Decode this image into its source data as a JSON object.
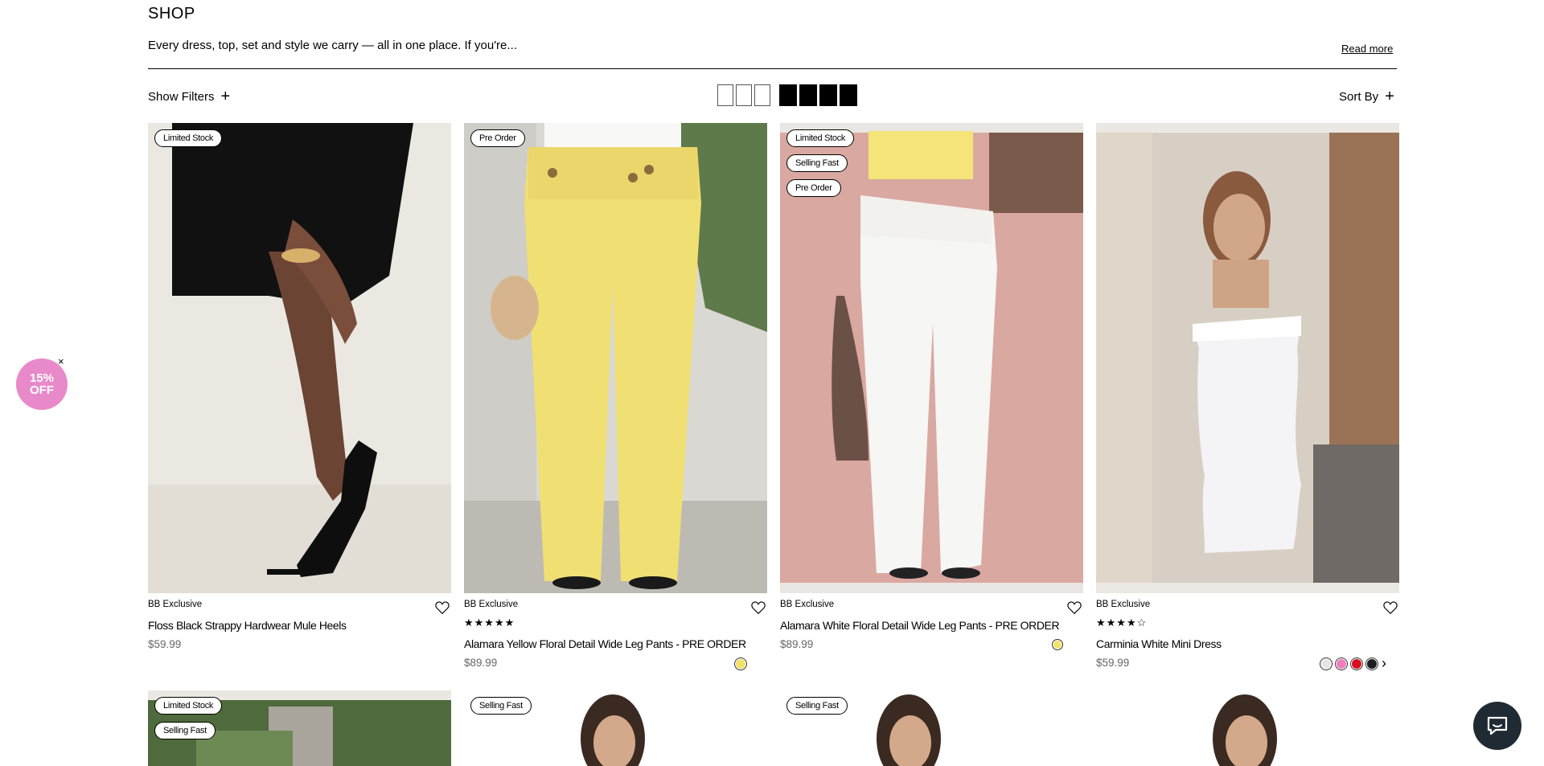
{
  "header": {
    "title": "SHOP",
    "intro": "Every dress, top, set and style we carry — all in one place. If you're...",
    "read_more": "Read more"
  },
  "toolbar": {
    "show_filters": "Show Filters",
    "sort_by": "Sort By"
  },
  "products": [
    {
      "badges": [
        "Limited Stock"
      ],
      "brand": "BB Exclusive",
      "name": "Floss Black Strappy Hardwear Mule Heels",
      "price": "$59.99",
      "swatches": []
    },
    {
      "badges": [
        "Pre Order"
      ],
      "brand": "BB Exclusive",
      "rating": 5,
      "name": "Alamara Yellow Floral Detail Wide Leg Pants - PRE ORDER",
      "price": "$89.99",
      "swatches": [
        "#f3e26a"
      ]
    },
    {
      "badges": [
        "Limited Stock",
        "Selling Fast",
        "Pre Order"
      ],
      "brand": "BB Exclusive",
      "name": "Alamara White Floral Detail Wide Leg Pants - PRE ORDER",
      "price": "$89.99",
      "swatches": [
        "#f3e26a"
      ]
    },
    {
      "badges": [],
      "brand": "BB Exclusive",
      "rating": 4,
      "name": "Carminia White Mini Dress",
      "price": "$59.99",
      "swatches": [
        "#e6e6e6",
        "#ee7fbd",
        "#d8101e",
        "#1e1e1e"
      ]
    }
  ],
  "row2_badges": [
    [
      "Limited Stock",
      "Selling Fast"
    ],
    [
      "Selling Fast"
    ],
    [
      "Selling Fast"
    ],
    []
  ],
  "promo": {
    "line1": "15%",
    "line2": "OFF",
    "close": "×"
  },
  "colors": {
    "promo": "#e889c9",
    "chat": "#1f2a33"
  }
}
